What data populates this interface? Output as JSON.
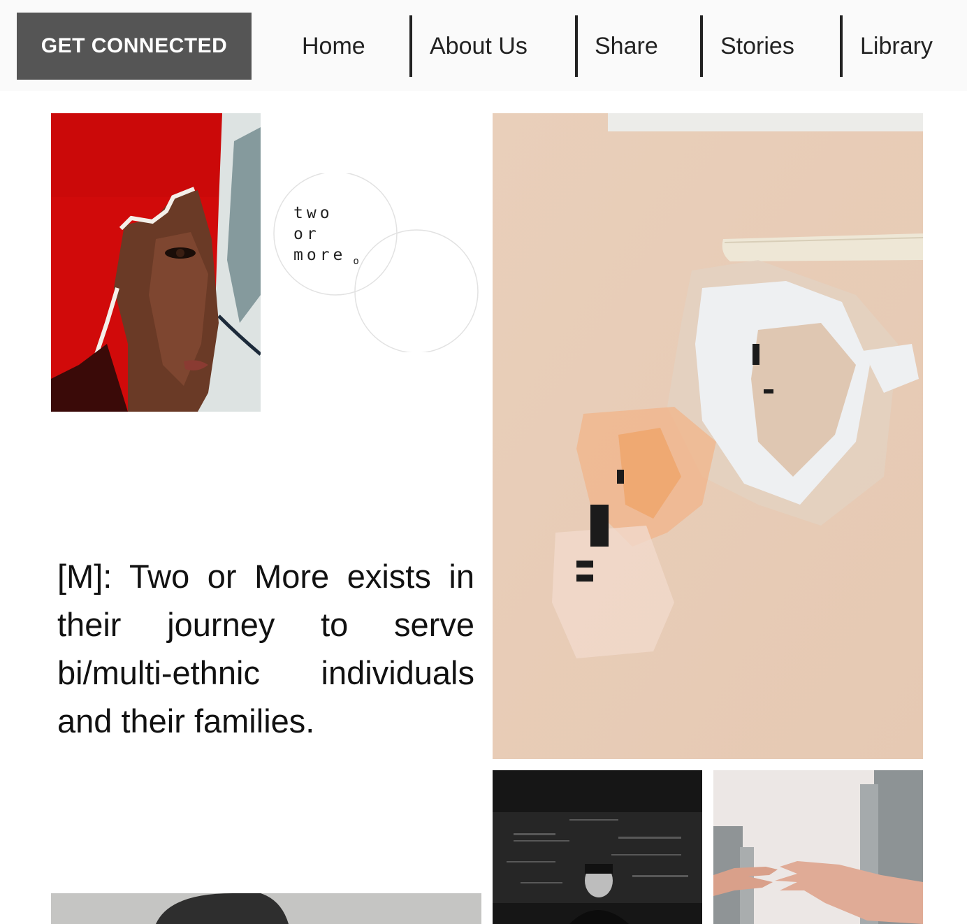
{
  "header": {
    "cta_label": "GET CONNECTED",
    "nav": [
      {
        "label": "Home"
      },
      {
        "label": "About Us"
      },
      {
        "label": "Share"
      },
      {
        "label": "Stories"
      },
      {
        "label": "Library"
      }
    ]
  },
  "logo": {
    "lines": [
      "two",
      "or",
      "more"
    ],
    "mark": "o"
  },
  "mission": {
    "text": "[M]: Two or More exists in their journey to serve bi/multi-ethnic individuals and their families."
  },
  "colors": {
    "cta_bg": "#555555",
    "header_bg": "#fafafa",
    "nav_text": "#222222"
  }
}
